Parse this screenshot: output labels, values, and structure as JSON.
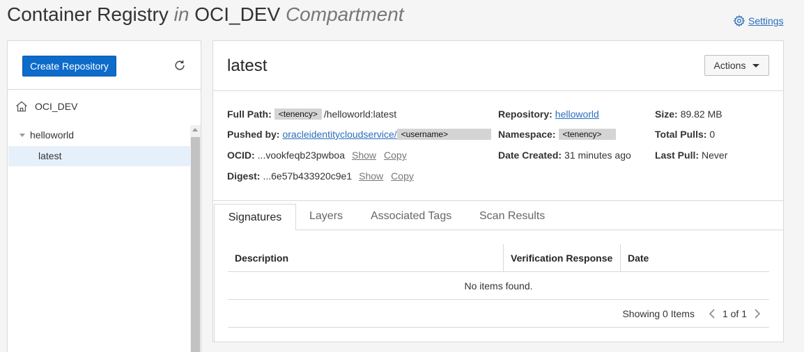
{
  "header": {
    "title": "Container Registry",
    "in_word": "in",
    "compartment_name": "OCI_DEV",
    "compartment_word": "Compartment",
    "settings_label": "Settings"
  },
  "sidebar": {
    "create_button": "Create Repository",
    "root_label": "OCI_DEV",
    "repo_label": "helloworld",
    "image_label": "latest"
  },
  "detail": {
    "title": "latest",
    "actions_label": "Actions",
    "full_path_label": "Full Path:",
    "full_path_tenancy": "<tenency>",
    "full_path_value": "/helloworld:latest",
    "pushed_by_label": "Pushed by:",
    "pushed_by_value": "oracleidentitycloudservice/",
    "pushed_by_user": "<username>",
    "ocid_label": "OCID:",
    "ocid_value": "...vookfeqb23pwboa",
    "digest_label": "Digest:",
    "digest_value": "...6e57b433920c9e1",
    "show_label": "Show",
    "copy_label": "Copy",
    "repository_label": "Repository:",
    "repository_value": "helloworld",
    "namespace_label": "Namespace:",
    "namespace_value": "<tenency>",
    "date_created_label": "Date Created:",
    "date_created_value": "31 minutes ago",
    "size_label": "Size:",
    "size_value": "89.82 MB",
    "total_pulls_label": "Total Pulls:",
    "total_pulls_value": "0",
    "last_pull_label": "Last Pull:",
    "last_pull_value": "Never"
  },
  "tabs": [
    "Signatures",
    "Layers",
    "Associated Tags",
    "Scan Results"
  ],
  "table": {
    "columns": [
      "Description",
      "Verification Response",
      "Date"
    ],
    "empty_text": "No items found.",
    "showing_text": "Showing 0 Items",
    "page_text": "1 of 1"
  },
  "colors": {
    "primary": "#0d6bca",
    "link": "#2a6ebb",
    "selected_row": "#e6f0fa"
  }
}
